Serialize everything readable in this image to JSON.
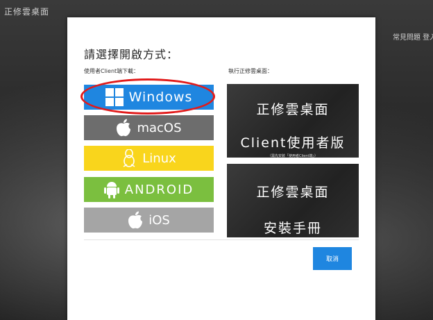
{
  "app": {
    "title": "正修雲桌面"
  },
  "header_links": {
    "text": "常見問題  登入桌面"
  },
  "modal": {
    "title": "請選擇開啟方式：",
    "left_label": "使用者Client端下載：",
    "right_label": "執行正修雲桌面：",
    "os_buttons": [
      {
        "label": "Windows",
        "icon": "windows-logo",
        "color": "#1f86e0"
      },
      {
        "label": "macOS",
        "icon": "apple-logo",
        "color": "#6d6d6d"
      },
      {
        "label": "Linux",
        "icon": "linux-penguin",
        "color": "#f9d51c"
      },
      {
        "label": "ANDROID",
        "icon": "android-robot",
        "color": "#7bbf3f"
      },
      {
        "label": "iOS",
        "icon": "apple-logo",
        "color": "#a5a5a5"
      }
    ],
    "tiles": [
      {
        "line1": "正修雲桌面",
        "line2": "Client使用者版",
        "sub": "（需先安裝「使用者Client端」）"
      },
      {
        "line1": "正修雲桌面",
        "line2": "安裝手冊"
      }
    ],
    "cancel_label": "取消"
  },
  "highlight_color": "#e11b1b"
}
